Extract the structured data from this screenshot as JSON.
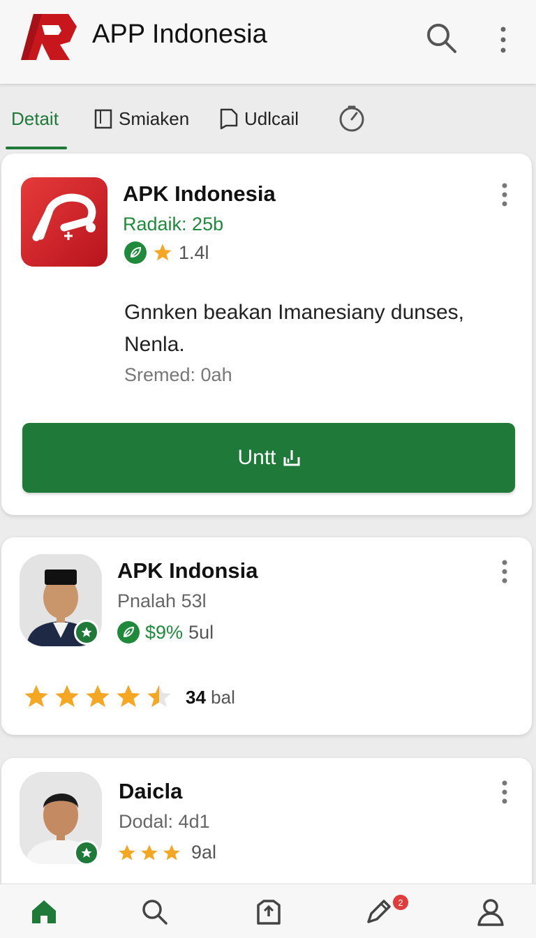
{
  "appbar": {
    "title": "APP Indonesia"
  },
  "tabs": [
    {
      "label": "Detait"
    },
    {
      "label": "Smiaken"
    },
    {
      "label": "Udlcail"
    },
    {
      "label": ""
    }
  ],
  "featured": {
    "name": "APK Indonesia",
    "rank": "Radaik: 25b",
    "rating": "1.4l",
    "description": "Gnnken beakan Imanesiany dunses, Nenla.",
    "released": "Sremed: 0ah",
    "install_label": "Untt"
  },
  "items": [
    {
      "name": "APK Indonsia",
      "sub": "Pnalah 53l",
      "price": "$9%",
      "price_suffix": "5ul",
      "stars": 4.5,
      "review_count": "34",
      "review_suffix": "bal"
    },
    {
      "name": "Daicla",
      "sub": "Dodal: 4d1",
      "stars": 3,
      "review_text": "9al"
    }
  ],
  "bottom_nav": {
    "notification_count": "2"
  },
  "colors": {
    "accent": "#1f7a3a",
    "brand_red": "#c8161d",
    "star": "#f5a623",
    "badge": "#e23b3b"
  },
  "icons": [
    "app-logo-icon",
    "search-icon",
    "more-vert-icon",
    "bookmark-icon",
    "document-icon",
    "timer-icon",
    "leaf-icon",
    "star-icon",
    "install-icon",
    "home-icon",
    "store-icon",
    "edit-icon",
    "profile-icon"
  ]
}
